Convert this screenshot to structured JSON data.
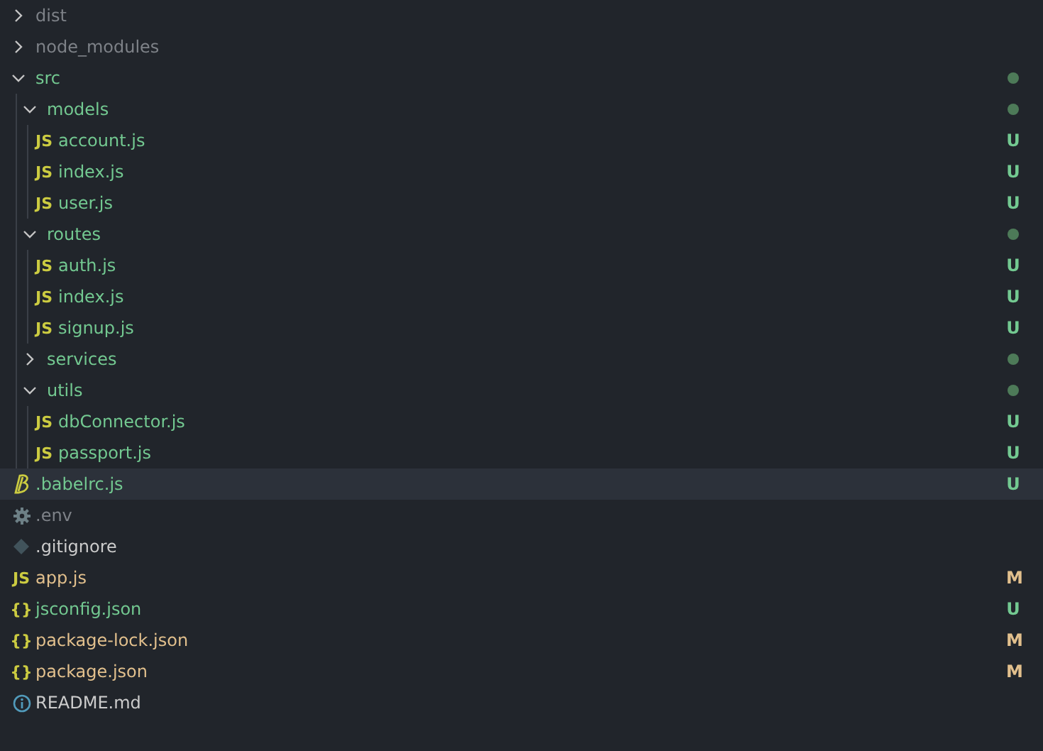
{
  "explorer": {
    "items": [
      {
        "name": "dist",
        "kind": "folder",
        "expanded": false,
        "color": "#7e8288",
        "dot": false,
        "selected": false
      },
      {
        "name": "node_modules",
        "kind": "folder",
        "expanded": false,
        "color": "#7e8288",
        "dot": false,
        "selected": false
      },
      {
        "name": "src",
        "kind": "folder",
        "expanded": true,
        "color": "#73c991",
        "dot": true,
        "selected": false,
        "children": [
          {
            "name": "models",
            "kind": "folder",
            "expanded": true,
            "color": "#73c991",
            "dot": true,
            "selected": false,
            "children": [
              {
                "name": "account.js",
                "kind": "js",
                "icon_text": "JS",
                "color": "#73c991",
                "badge": "U",
                "selected": false
              },
              {
                "name": "index.js",
                "kind": "js",
                "icon_text": "JS",
                "color": "#73c991",
                "badge": "U",
                "selected": false
              },
              {
                "name": "user.js",
                "kind": "js",
                "icon_text": "JS",
                "color": "#73c991",
                "badge": "U",
                "selected": false
              }
            ]
          },
          {
            "name": "routes",
            "kind": "folder",
            "expanded": true,
            "color": "#73c991",
            "dot": true,
            "selected": false,
            "children": [
              {
                "name": "auth.js",
                "kind": "js",
                "icon_text": "JS",
                "color": "#73c991",
                "badge": "U",
                "selected": false
              },
              {
                "name": "index.js",
                "kind": "js",
                "icon_text": "JS",
                "color": "#73c991",
                "badge": "U",
                "selected": false
              },
              {
                "name": "signup.js",
                "kind": "js",
                "icon_text": "JS",
                "color": "#73c991",
                "badge": "U",
                "selected": false
              }
            ]
          },
          {
            "name": "services",
            "kind": "folder",
            "expanded": false,
            "color": "#73c991",
            "dot": true,
            "selected": false
          },
          {
            "name": "utils",
            "kind": "folder",
            "expanded": true,
            "color": "#73c991",
            "dot": true,
            "selected": false,
            "children": [
              {
                "name": "dbConnector.js",
                "kind": "js",
                "icon_text": "JS",
                "color": "#73c991",
                "badge": "U",
                "selected": false
              },
              {
                "name": "passport.js",
                "kind": "js",
                "icon_text": "JS",
                "color": "#73c991",
                "badge": "U",
                "selected": false
              }
            ]
          }
        ]
      },
      {
        "name": ".babelrc.js",
        "kind": "babel",
        "color": "#73c991",
        "badge": "U",
        "selected": true
      },
      {
        "name": ".env",
        "kind": "gear",
        "color": "#7e8288",
        "selected": false
      },
      {
        "name": ".gitignore",
        "kind": "git",
        "color": "#cccccc",
        "selected": false
      },
      {
        "name": "app.js",
        "kind": "js",
        "icon_text": "JS",
        "color": "#e2c08d",
        "badge": "M",
        "selected": false
      },
      {
        "name": "jsconfig.json",
        "kind": "json",
        "icon_text": "{}",
        "color": "#73c991",
        "badge": "U",
        "selected": false
      },
      {
        "name": "package-lock.json",
        "kind": "json",
        "icon_text": "{}",
        "color": "#e2c08d",
        "badge": "M",
        "selected": false
      },
      {
        "name": "package.json",
        "kind": "json",
        "icon_text": "{}",
        "color": "#e2c08d",
        "badge": "M",
        "selected": false
      },
      {
        "name": "README.md",
        "kind": "info",
        "color": "#cccccc",
        "selected": false
      }
    ]
  }
}
